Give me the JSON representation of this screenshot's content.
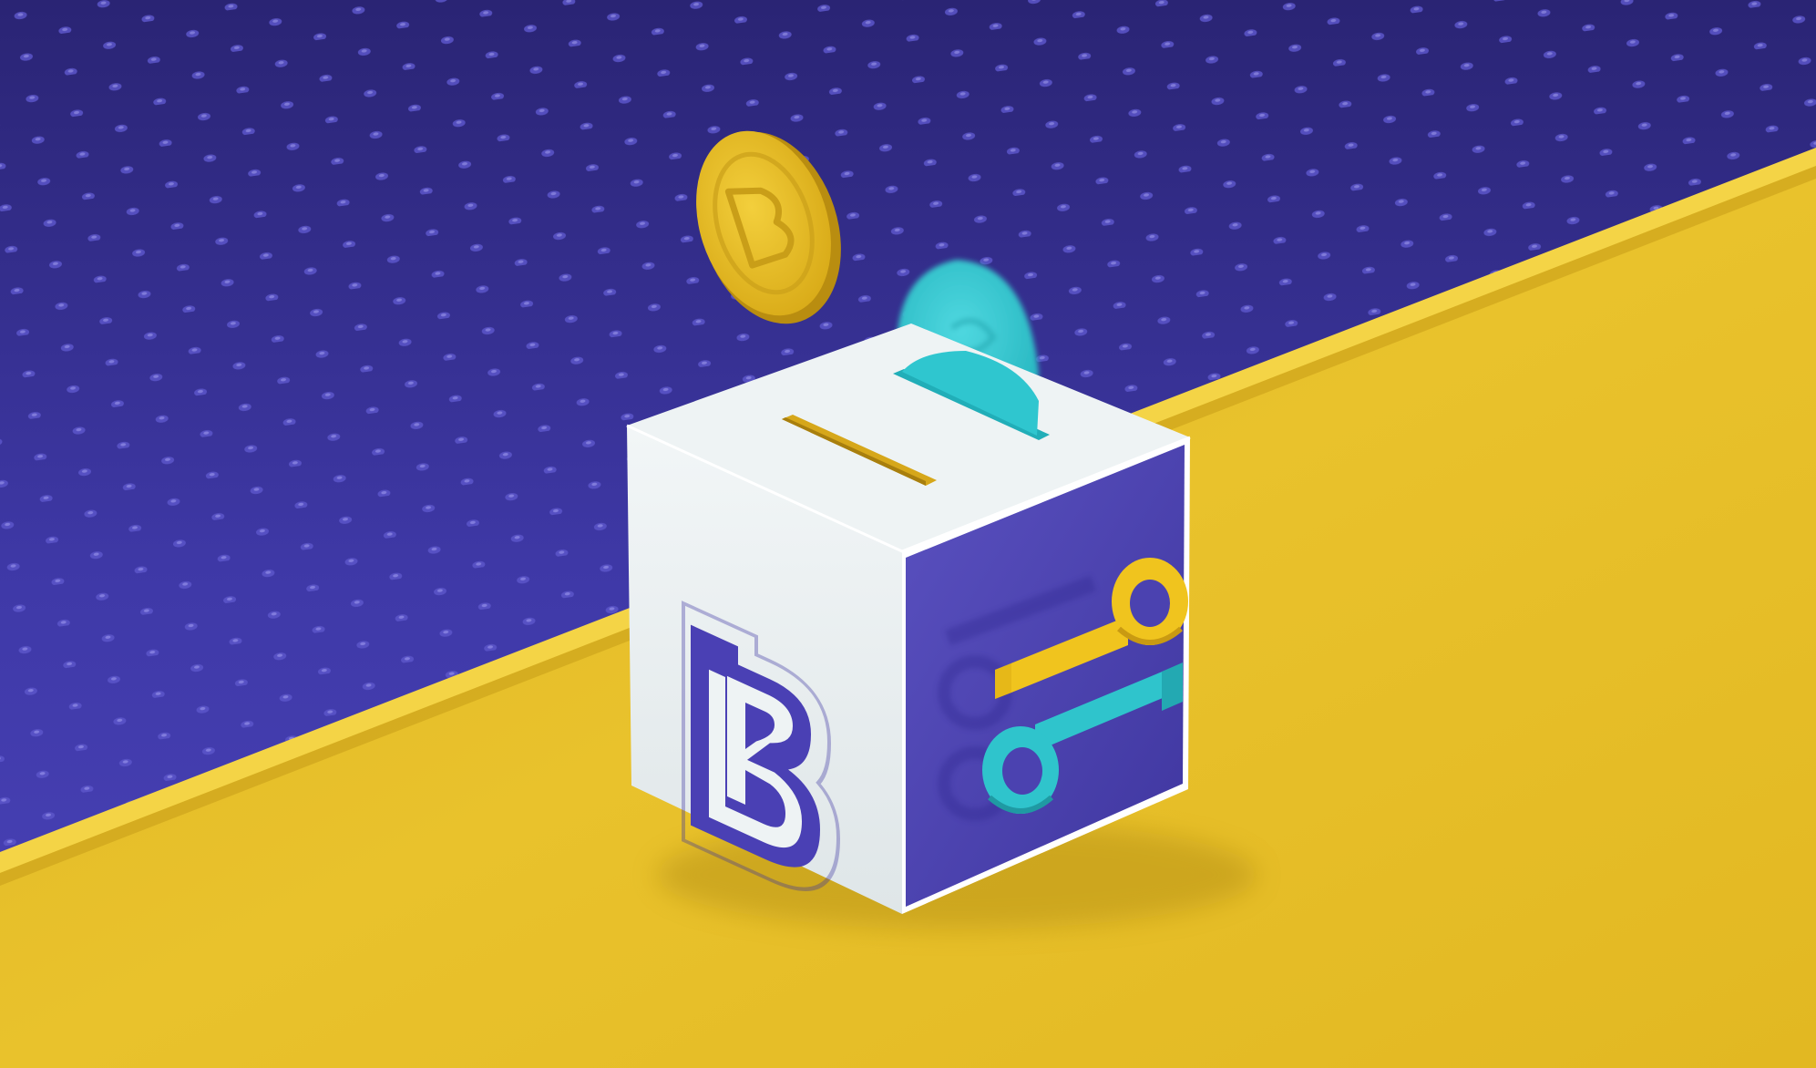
{
  "scene": {
    "description_free": true,
    "palette": {
      "backdrop_dark": "#2a2474",
      "backdrop_mid": "#3f39a8",
      "backdrop_light": "#4a43b8",
      "floor": "#e7bf2a",
      "floor_shadow": "#c9a01c",
      "ledge": "#f2cf3a",
      "box_top": "#eef3f4",
      "box_left": "#e6ecee",
      "box_right": "#4b42b0",
      "slot": "#d9a91c",
      "coin_gold": "#e6b91e",
      "coin_cyan": "#2fc6cf",
      "logo_purple": "#4a40b4",
      "key_yellow": "#efc21c",
      "key_cyan": "#2fc4cc"
    },
    "icons": [
      "brand-b-logo-icon",
      "key-yellow-icon",
      "key-cyan-icon",
      "gold-coin-icon",
      "cyan-coin-icon"
    ]
  }
}
